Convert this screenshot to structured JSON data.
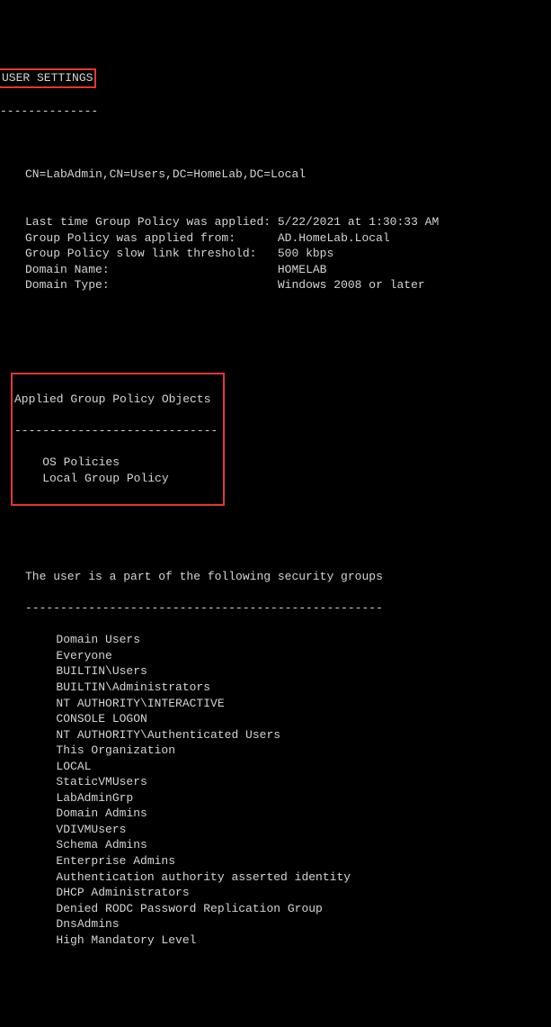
{
  "header": {
    "title": "USER SETTINGS",
    "title_dashes": "--------------"
  },
  "user_info": {
    "dn": "CN=LabAdmin,CN=Users,DC=HomeLab,DC=Local",
    "rows": [
      {
        "key": "Last time Group Policy was applied:",
        "val": "5/22/2021 at 1:30:33 AM"
      },
      {
        "key": "Group Policy was applied from:     ",
        "val": "AD.HomeLab.Local"
      },
      {
        "key": "Group Policy slow link threshold:  ",
        "val": "500 kbps"
      },
      {
        "key": "Domain Name:                       ",
        "val": "HOMELAB"
      },
      {
        "key": "Domain Type:                       ",
        "val": "Windows 2008 or later"
      }
    ]
  },
  "gpo_section": {
    "title": "Applied Group Policy Objects",
    "dashes": "-----------------------------",
    "items": [
      "OS Policies",
      "Local Group Policy"
    ]
  },
  "groups_section": {
    "title": "The user is a part of the following security groups",
    "dashes": "---------------------------------------------------",
    "items": [
      "Domain Users",
      "Everyone",
      "BUILTIN\\Users",
      "BUILTIN\\Administrators",
      "NT AUTHORITY\\INTERACTIVE",
      "CONSOLE LOGON",
      "NT AUTHORITY\\Authenticated Users",
      "This Organization",
      "LOCAL",
      "StaticVMUsers",
      "LabAdminGrp",
      "Domain Admins",
      "VDIVMUsers",
      "Schema Admins",
      "Enterprise Admins",
      "Authentication authority asserted identity",
      "DHCP Administrators",
      "Denied RODC Password Replication Group",
      "DnsAdmins",
      "High Mandatory Level"
    ]
  }
}
